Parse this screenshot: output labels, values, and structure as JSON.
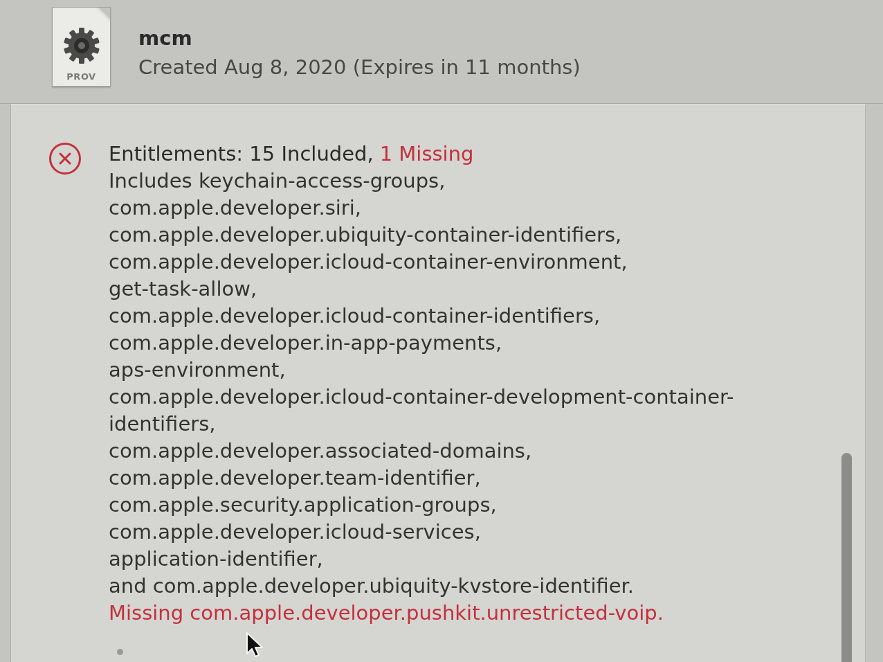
{
  "profile": {
    "file_icon_label": "PROV",
    "name": "mcm",
    "created": "Created Aug 8, 2020 (Expires in 11 months)"
  },
  "entitlements": {
    "error": true,
    "summary": "Entitlements: 15 Included,",
    "missing_count": "1 Missing",
    "included": "Includes keychain-access-groups,\ncom.apple.developer.siri,\ncom.apple.developer.ubiquity-container-identifiers,\ncom.apple.developer.icloud-container-environment,\nget-task-allow,\ncom.apple.developer.icloud-container-identifiers,\ncom.apple.developer.in-app-payments,\naps-environment,\ncom.apple.developer.icloud-container-development-container-identifiers,\ncom.apple.developer.associated-domains,\ncom.apple.developer.team-identifier,\ncom.apple.security.application-groups,\ncom.apple.developer.icloud-services,\napplication-identifier,\nand com.apple.developer.ubiquity-kvstore-identifier.",
    "missing": "Missing com.apple.developer.pushkit.unrestricted-voip."
  }
}
